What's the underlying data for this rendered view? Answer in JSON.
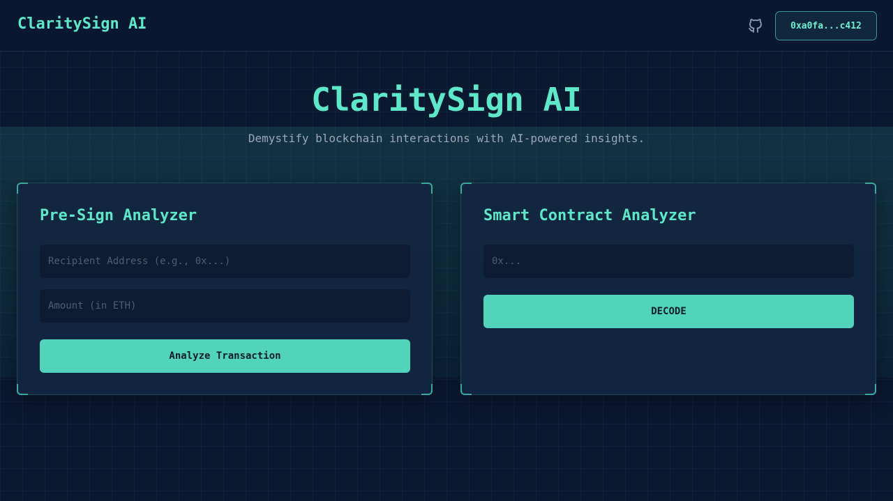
{
  "header": {
    "brand": "ClaritySign AI",
    "github_icon": "github-icon",
    "wallet_label": "0xa0fa...c412"
  },
  "hero": {
    "title": "ClaritySign AI",
    "subtitle": "Demystify blockchain interactions with AI-powered insights."
  },
  "pre_sign": {
    "title": "Pre-Sign Analyzer",
    "recipient_placeholder": "Recipient Address (e.g., 0x...)",
    "amount_placeholder": "Amount (in ETH)",
    "analyze_label": "Analyze Transaction"
  },
  "contract": {
    "title": "Smart Contract Analyzer",
    "address_placeholder": "0x...",
    "decode_label": "DECODE"
  },
  "colors": {
    "accent": "#5ee8c9",
    "button": "#52d4bc",
    "background": "#0a1830"
  }
}
